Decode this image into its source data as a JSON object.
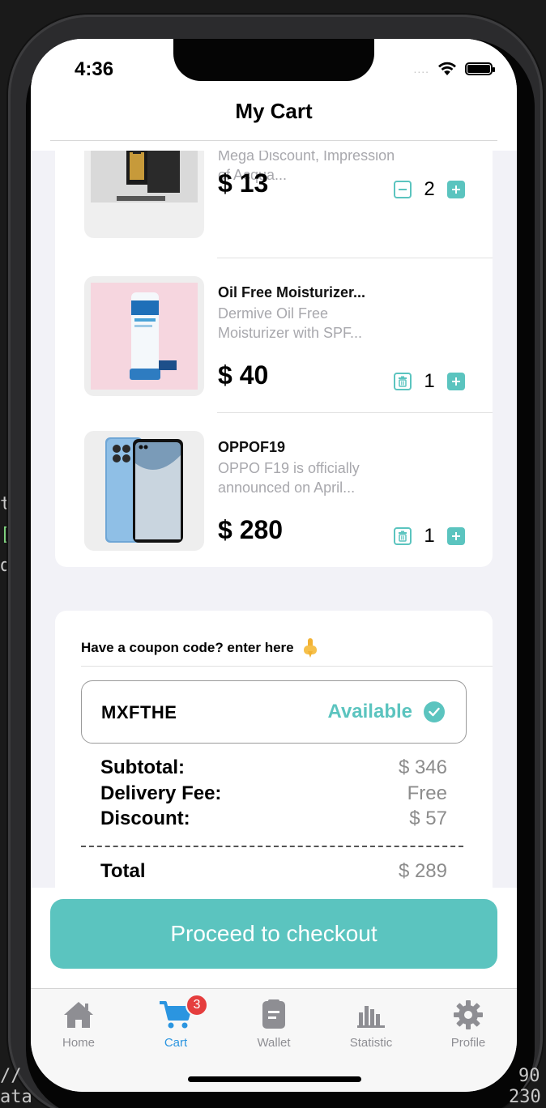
{
  "backdrop": {
    "left_lines": [
      "t",
      "[",
      "d"
    ],
    "bottom_left": "//",
    "bottom_left2": "ata",
    "bottom_right": "90",
    "bottom_right2": "230"
  },
  "status_bar": {
    "time": "4:36",
    "signal": "....",
    "wifi_icon": "wifi-icon",
    "battery_icon": "battery-icon"
  },
  "header": {
    "title": "My Cart"
  },
  "cart": {
    "items": [
      {
        "name": "",
        "description": "Mega Discount, Impression of Acqua...",
        "price": "$ 13",
        "quantity": "2",
        "decrement_icon": "minus-icon",
        "increment_icon": "plus-icon"
      },
      {
        "name": "Oil Free Moisturizer...",
        "description": "Dermive Oil Free Moisturizer with SPF...",
        "price": "$ 40",
        "quantity": "1",
        "decrement_icon": "trash-icon",
        "increment_icon": "plus-icon"
      },
      {
        "name": "OPPOF19",
        "description": "OPPO F19 is officially announced on April...",
        "price": "$ 280",
        "quantity": "1",
        "decrement_icon": "trash-icon",
        "increment_icon": "plus-icon"
      }
    ]
  },
  "coupon": {
    "prompt": "Have a coupon code? enter here",
    "prompt_icon": "pointing-down-icon",
    "code": "MXFTHE",
    "status": "Available"
  },
  "summary": {
    "subtotal_label": "Subtotal:",
    "subtotal_value": "$ 346",
    "delivery_label": "Delivery Fee:",
    "delivery_value": "Free",
    "discount_label": "Discount:",
    "discount_value": "$ 57",
    "total_label": "Total",
    "total_value": "$ 289"
  },
  "checkout": {
    "label": "Proceed to checkout"
  },
  "tabs": [
    {
      "label": "Home",
      "icon": "home-icon",
      "active": false
    },
    {
      "label": "Cart",
      "icon": "cart-icon",
      "active": true,
      "badge": "3"
    },
    {
      "label": "Wallet",
      "icon": "wallet-icon",
      "active": false
    },
    {
      "label": "Statistic",
      "icon": "statistic-icon",
      "active": false
    },
    {
      "label": "Profile",
      "icon": "gear-icon",
      "active": false
    }
  ],
  "colors": {
    "accent": "#5bc4bf",
    "active_tab": "#2b95e0",
    "badge": "#e53e3e",
    "tab_inactive": "#8e8e93"
  }
}
